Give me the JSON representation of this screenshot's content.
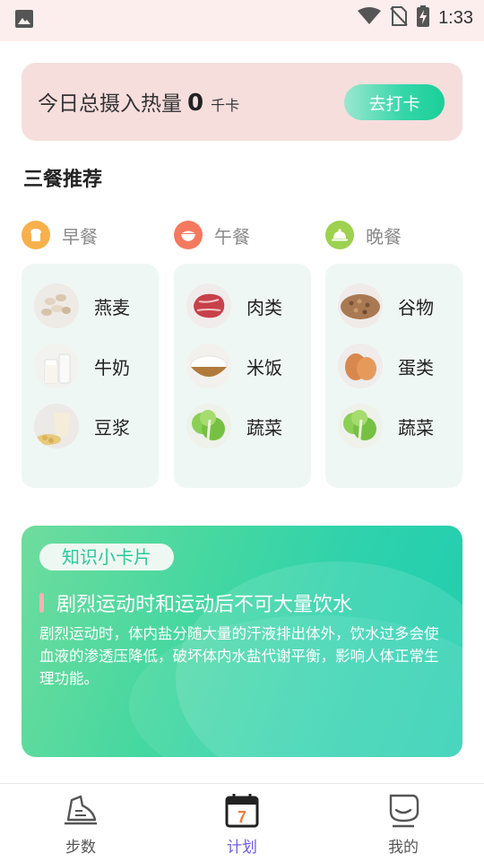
{
  "status_bar": {
    "time": "1:33"
  },
  "calorie_card": {
    "label": "今日总摄入热量",
    "value": "0",
    "unit": "千卡",
    "checkin_label": "去打卡"
  },
  "section_title": "三餐推荐",
  "meals": [
    {
      "name": "早餐",
      "foods": [
        {
          "name": "燕麦"
        },
        {
          "name": "牛奶"
        },
        {
          "name": "豆浆"
        }
      ]
    },
    {
      "name": "午餐",
      "foods": [
        {
          "name": "肉类"
        },
        {
          "name": "米饭"
        },
        {
          "name": "蔬菜"
        }
      ]
    },
    {
      "name": "晚餐",
      "foods": [
        {
          "name": "谷物"
        },
        {
          "name": "蛋类"
        },
        {
          "name": "蔬菜"
        }
      ]
    }
  ],
  "knowledge": {
    "badge": "知识小卡片",
    "title": "剧烈运动时和运动后不可大量饮水",
    "body": "剧烈运动时，体内盐分随大量的汗液排出体外，饮水过多会使血液的渗透压降低，破坏体内水盐代谢平衡，影响人体正常生理功能。"
  },
  "nav": [
    {
      "label": "步数",
      "icon": "shoe-icon",
      "active": false
    },
    {
      "label": "计划",
      "icon": "calendar-icon",
      "active": true,
      "icon_text": "7"
    },
    {
      "label": "我的",
      "icon": "profile-icon",
      "active": false
    }
  ],
  "colors": {
    "active_nav": "#6f5ce8",
    "inactive_nav": "#555555",
    "accent_green": "#2cc79b"
  }
}
